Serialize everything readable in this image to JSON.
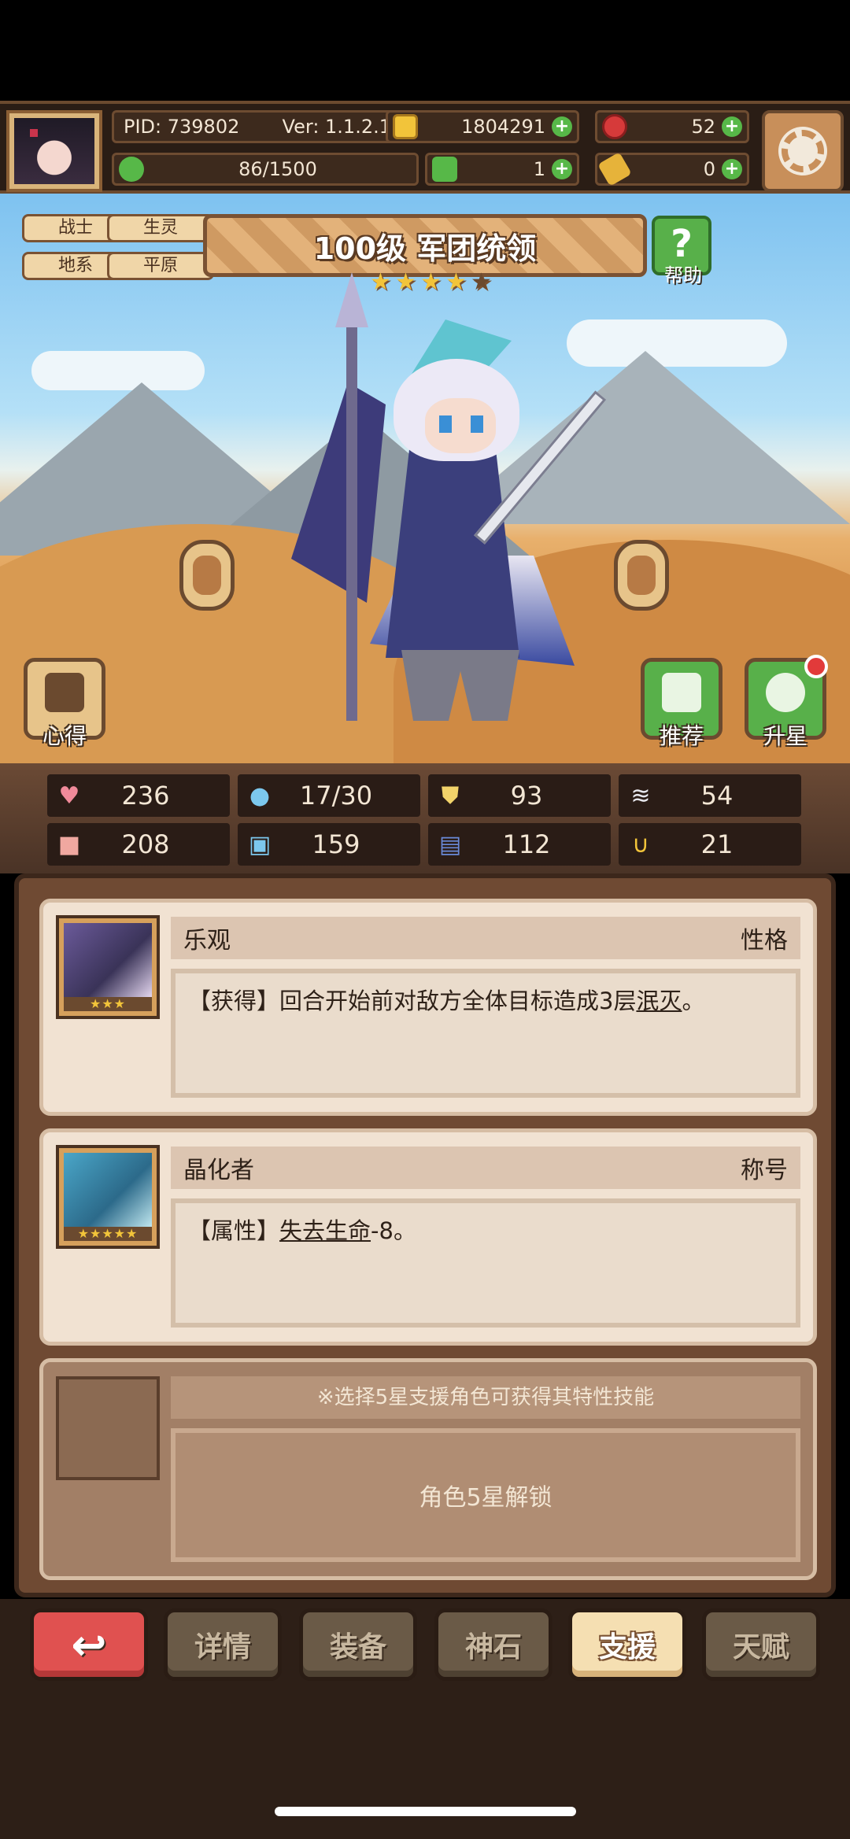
{
  "header": {
    "pid": "PID: 739802",
    "version": "Ver: 1.1.2.1",
    "gold": "1804291",
    "gems": "52",
    "energy": "86/1500",
    "clover": "1",
    "key": "0"
  },
  "hero": {
    "tags": [
      "战士",
      "生灵",
      "地系",
      "平原"
    ],
    "title": "100级 军团统领",
    "stars_filled": 4,
    "stars_total": 5,
    "help_label": "帮助",
    "insight_label": "心得",
    "recommend_label": "推荐",
    "starup_label": "升星"
  },
  "stats": [
    {
      "icon": "heart-icon",
      "value": "236"
    },
    {
      "icon": "drop-icon",
      "value": "17/30"
    },
    {
      "icon": "shield-icon",
      "value": "93"
    },
    {
      "icon": "wing-icon",
      "value": "54"
    },
    {
      "icon": "fist-icon",
      "value": "208"
    },
    {
      "icon": "book-icon",
      "value": "159"
    },
    {
      "icon": "boot-icon",
      "value": "112"
    },
    {
      "icon": "horseshoe-icon",
      "value": "21"
    }
  ],
  "support": {
    "cards": [
      {
        "name": "乐观",
        "type": "性格",
        "stars": "★★★",
        "desc_prefix": "【获得】回合开始前对敌方全体目标造成3层",
        "desc_link": "泯灭",
        "desc_suffix": "。"
      },
      {
        "name": "晶化者",
        "type": "称号",
        "stars": "★★★★★",
        "desc_prefix": "【属性】",
        "desc_link": "失去生命",
        "desc_suffix": "-8。"
      }
    ],
    "locked_hint": "※选择5星支援角色可获得其特性技能",
    "locked_text": "角色5星解锁"
  },
  "tabs": {
    "back": "↩",
    "items": [
      "详情",
      "装备",
      "神石",
      "支援",
      "天赋"
    ],
    "active": "支援"
  },
  "colors": {
    "accent_green": "#58b04a",
    "back_red": "#e05150",
    "star_gold": "#f2c43a"
  }
}
